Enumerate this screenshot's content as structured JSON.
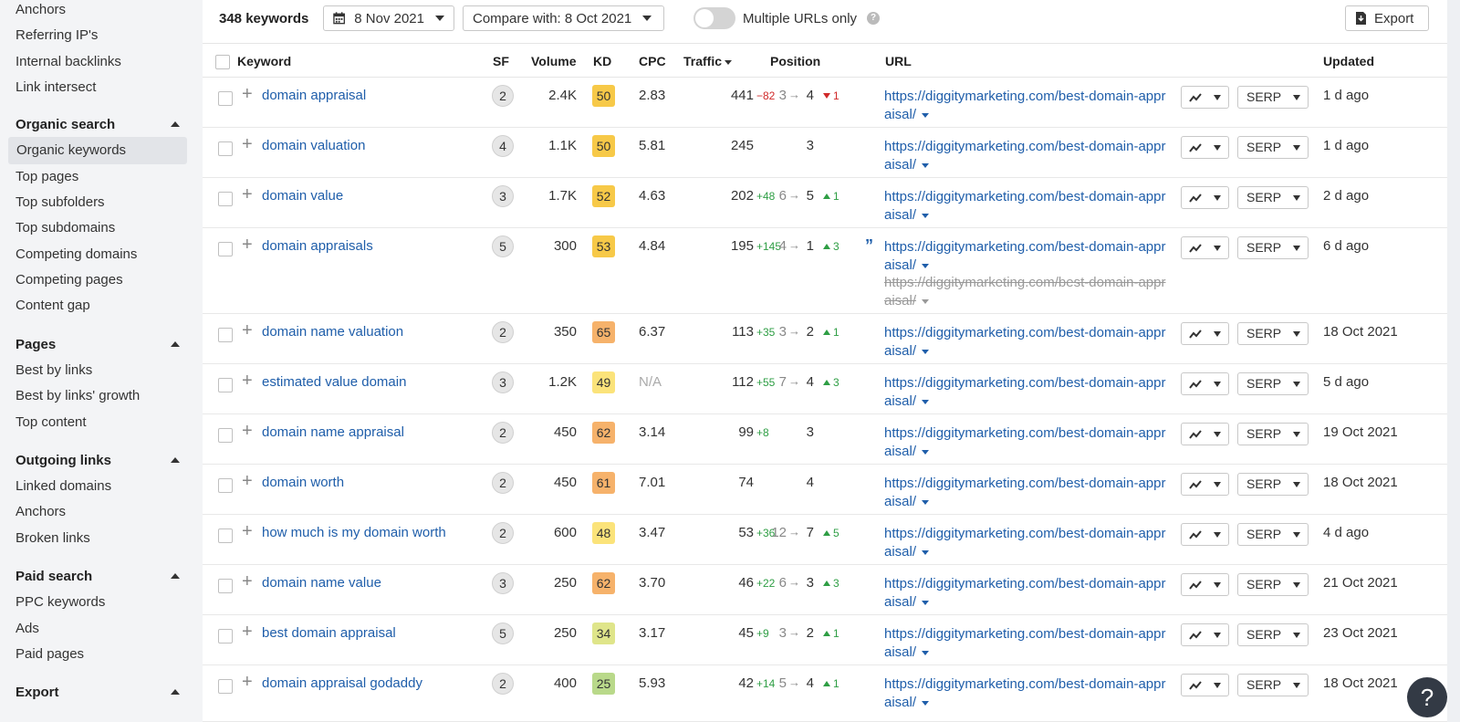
{
  "sidebar": {
    "top_items": [
      "Anchors",
      "Referring IP's",
      "Internal backlinks",
      "Link intersect"
    ],
    "sections": [
      {
        "title": "Organic search",
        "items": [
          "Organic keywords",
          "Top pages",
          "Top subfolders",
          "Top subdomains",
          "Competing domains",
          "Competing pages",
          "Content gap"
        ],
        "active": "Organic keywords"
      },
      {
        "title": "Pages",
        "items": [
          "Best by links",
          "Best by links' growth",
          "Top content"
        ]
      },
      {
        "title": "Outgoing links",
        "items": [
          "Linked domains",
          "Anchors",
          "Broken links"
        ]
      },
      {
        "title": "Paid search",
        "items": [
          "PPC keywords",
          "Ads",
          "Paid pages"
        ]
      },
      {
        "title": "Export",
        "items": []
      }
    ]
  },
  "toolbar": {
    "keyword_count": "348 keywords",
    "date": "8 Nov 2021",
    "compare": "Compare with: 8 Oct 2021",
    "toggle_label": "Multiple URLs only",
    "help": "?",
    "export_label": "Export"
  },
  "table": {
    "headers": {
      "keyword": "Keyword",
      "sf": "SF",
      "volume": "Volume",
      "kd": "KD",
      "cpc": "CPC",
      "traffic": "Traffic",
      "position": "Position",
      "url": "URL",
      "updated": "Updated"
    },
    "serp_label": "SERP",
    "rows": [
      {
        "keyword": "domain appraisal",
        "sf": "2",
        "volume": "2.4K",
        "kd": "50",
        "kd_color": "#f7c948",
        "cpc": "2.83",
        "traffic": "441",
        "traffic_change": "−82",
        "traffic_dir": "neg",
        "pos_old": "3",
        "pos_new": "4",
        "pos_change": "1",
        "pos_dir": "down",
        "url": "https://diggitymarketing.com/best-domain-appraisal/",
        "updated": "1 d ago"
      },
      {
        "keyword": "domain valuation",
        "sf": "4",
        "volume": "1.1K",
        "kd": "50",
        "kd_color": "#f7c948",
        "cpc": "5.81",
        "traffic": "245",
        "traffic_change": "",
        "traffic_dir": "",
        "pos_old": "",
        "pos_new": "3",
        "pos_change": "",
        "pos_dir": "",
        "url": "https://diggitymarketing.com/best-domain-appraisal/",
        "updated": "1 d ago"
      },
      {
        "keyword": "domain value",
        "sf": "3",
        "volume": "1.7K",
        "kd": "52",
        "kd_color": "#f7c948",
        "cpc": "4.63",
        "traffic": "202",
        "traffic_change": "+48",
        "traffic_dir": "pos",
        "pos_old": "6",
        "pos_new": "5",
        "pos_change": "1",
        "pos_dir": "up",
        "url": "https://diggitymarketing.com/best-domain-appraisal/",
        "updated": "2 d ago"
      },
      {
        "keyword": "domain appraisals",
        "sf": "5",
        "volume": "300",
        "kd": "53",
        "kd_color": "#f7c948",
        "cpc": "4.84",
        "traffic": "195",
        "traffic_change": "+145",
        "traffic_dir": "pos",
        "pos_old": "4",
        "pos_new": "1",
        "pos_change": "3",
        "pos_dir": "up",
        "url": "https://diggitymarketing.com/best-domain-appraisal/",
        "url_old": "https://diggitymarketing.com/best-domain-appraisal/",
        "featured": true,
        "updated": "6 d ago"
      },
      {
        "keyword": "domain name valuation",
        "sf": "2",
        "volume": "350",
        "kd": "65",
        "kd_color": "#f6b26b",
        "cpc": "6.37",
        "traffic": "113",
        "traffic_change": "+35",
        "traffic_dir": "pos",
        "pos_old": "3",
        "pos_new": "2",
        "pos_change": "1",
        "pos_dir": "up",
        "url": "https://diggitymarketing.com/best-domain-appraisal/",
        "updated": "18 Oct 2021"
      },
      {
        "keyword": "estimated value domain",
        "sf": "3",
        "volume": "1.2K",
        "kd": "49",
        "kd_color": "#fbe37a",
        "cpc": "N/A",
        "traffic": "112",
        "traffic_change": "+55",
        "traffic_dir": "pos",
        "pos_old": "7",
        "pos_new": "4",
        "pos_change": "3",
        "pos_dir": "up",
        "url": "https://diggitymarketing.com/best-domain-appraisal/",
        "updated": "5 d ago"
      },
      {
        "keyword": "domain name appraisal",
        "sf": "2",
        "volume": "450",
        "kd": "62",
        "kd_color": "#f6b26b",
        "cpc": "3.14",
        "traffic": "99",
        "traffic_change": "+8",
        "traffic_dir": "pos",
        "pos_old": "",
        "pos_new": "3",
        "pos_change": "",
        "pos_dir": "",
        "url": "https://diggitymarketing.com/best-domain-appraisal/",
        "updated": "19 Oct 2021"
      },
      {
        "keyword": "domain worth",
        "sf": "2",
        "volume": "450",
        "kd": "61",
        "kd_color": "#f6b26b",
        "cpc": "7.01",
        "traffic": "74",
        "traffic_change": "",
        "traffic_dir": "",
        "pos_old": "",
        "pos_new": "4",
        "pos_change": "",
        "pos_dir": "",
        "url": "https://diggitymarketing.com/best-domain-appraisal/",
        "updated": "18 Oct 2021"
      },
      {
        "keyword": "how much is my domain worth",
        "sf": "2",
        "volume": "600",
        "kd": "48",
        "kd_color": "#fbe37a",
        "cpc": "3.47",
        "traffic": "53",
        "traffic_change": "+36",
        "traffic_dir": "pos",
        "pos_old": "12",
        "pos_new": "7",
        "pos_change": "5",
        "pos_dir": "up",
        "url": "https://diggitymarketing.com/best-domain-appraisal/",
        "updated": "4 d ago"
      },
      {
        "keyword": "domain name value",
        "sf": "3",
        "volume": "250",
        "kd": "62",
        "kd_color": "#f6b26b",
        "cpc": "3.70",
        "traffic": "46",
        "traffic_change": "+22",
        "traffic_dir": "pos",
        "pos_old": "6",
        "pos_new": "3",
        "pos_change": "3",
        "pos_dir": "up",
        "url": "https://diggitymarketing.com/best-domain-appraisal/",
        "updated": "21 Oct 2021"
      },
      {
        "keyword": "best domain appraisal",
        "sf": "5",
        "volume": "250",
        "kd": "34",
        "kd_color": "#dfe58a",
        "cpc": "3.17",
        "traffic": "45",
        "traffic_change": "+9",
        "traffic_dir": "pos",
        "pos_old": "3",
        "pos_new": "2",
        "pos_change": "1",
        "pos_dir": "up",
        "url": "https://diggitymarketing.com/best-domain-appraisal/",
        "updated": "23 Oct 2021"
      },
      {
        "keyword": "domain appraisal godaddy",
        "sf": "2",
        "volume": "400",
        "kd": "25",
        "kd_color": "#b9d98a",
        "cpc": "5.93",
        "traffic": "42",
        "traffic_change": "+14",
        "traffic_dir": "pos",
        "pos_old": "5",
        "pos_new": "4",
        "pos_change": "1",
        "pos_dir": "up",
        "url": "https://diggitymarketing.com/best-domain-appraisal/",
        "updated": "18 Oct 2021"
      }
    ]
  },
  "help_button": "?"
}
